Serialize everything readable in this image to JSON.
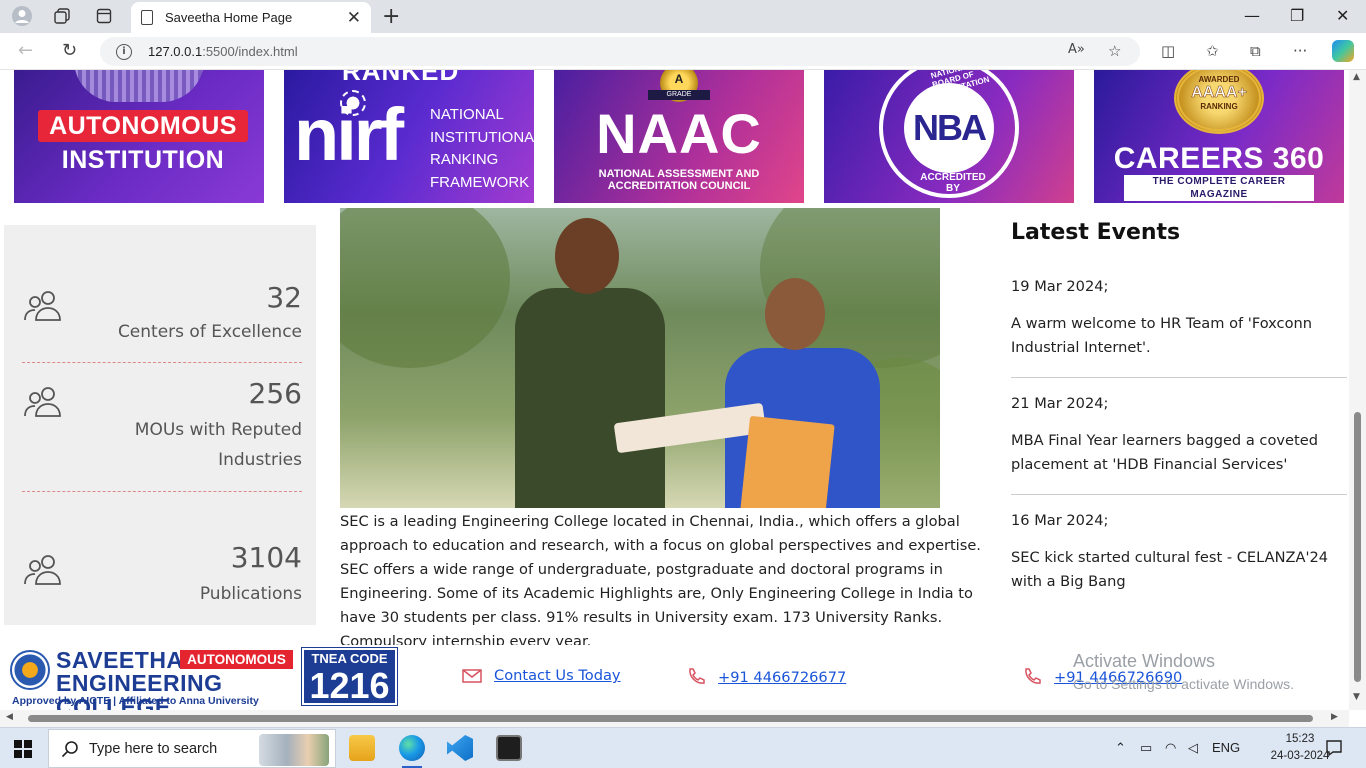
{
  "browser": {
    "tab_title": "Saveetha Home Page",
    "url_host": "127.0.0.1",
    "url_path": ":5500/index.html",
    "read_aloud_icon": "A»"
  },
  "banners": {
    "autonomous": {
      "line1": "AUTONOMOUS",
      "line2": "INSTITUTION"
    },
    "nirf": {
      "ranked": "RANKED",
      "logo": "nirf",
      "text_lines": [
        "NATIONAL",
        "INSTITUTIONAL",
        "RANKING",
        "FRAMEWORK"
      ]
    },
    "naac": {
      "grade": "A",
      "grade_label": "GRADE",
      "title": "NAAC",
      "sub1": "NATIONAL ASSESSMENT AND",
      "sub2": "ACCREDITATION  COUNCIL"
    },
    "nba": {
      "logo": "NBA",
      "top_text": "NATIONAL BOARD OF ACCREDITATION",
      "bottom_text": "ACCREDITED BY"
    },
    "careers360": {
      "awarded": "AWARDED",
      "grade": "AAAA+",
      "ranking": "RANKING",
      "title": "CAREERS 360",
      "sub": "THE COMPLETE CAREER MAGAZINE"
    }
  },
  "stats": [
    {
      "number": "32",
      "label_lines": [
        "Centers of Excellence"
      ]
    },
    {
      "number": "256",
      "label_lines": [
        "MOUs with Reputed",
        "Industries"
      ]
    },
    {
      "number": "3104",
      "label_lines": [
        "Publications"
      ]
    }
  ],
  "about_text": "SEC is a leading Engineering College located in Chennai, India., which offers a global approach to education and research, with a focus on global perspectives and expertise. SEC offers a wide range of undergraduate, postgraduate and doctoral programs in Engineering. Some of its Academic Highlights are, Only Engineering College in India to have 30 students per class. 91% results in University exam. 173 University Ranks. Compulsory internship every year.",
  "events": {
    "heading": "Latest Events",
    "items": [
      {
        "date": "19 Mar 2024;",
        "desc": "A warm welcome to HR Team of 'Foxconn Industrial Internet'."
      },
      {
        "date": "21 Mar 2024;",
        "desc": "MBA Final Year learners bagged a coveted placement at 'HDB Financial Services'"
      },
      {
        "date": "16 Mar 2024;",
        "desc": "SEC kick started cultural fest - CELANZA'24 with a Big Bang"
      }
    ]
  },
  "footer": {
    "logo_line1": "SAVEETHA",
    "logo_line2": "ENGINEERING COLLEGE",
    "logo_badge": "AUTONOMOUS",
    "logo_sub": "Approved by AICTE  |  Affiliated to Anna University",
    "tnea_label": "TNEA CODE",
    "tnea_code": "1216",
    "contact_label": " Contact Us Today",
    "phone1": " +91 4466726677",
    "phone2": " +91 4466726690"
  },
  "watermark": {
    "title": "Activate Windows",
    "subtitle": "Go to Settings to activate Windows."
  },
  "taskbar": {
    "search_placeholder": "Type here to search",
    "language": "ENG",
    "time": "15:23",
    "date": "24-03-2024"
  }
}
